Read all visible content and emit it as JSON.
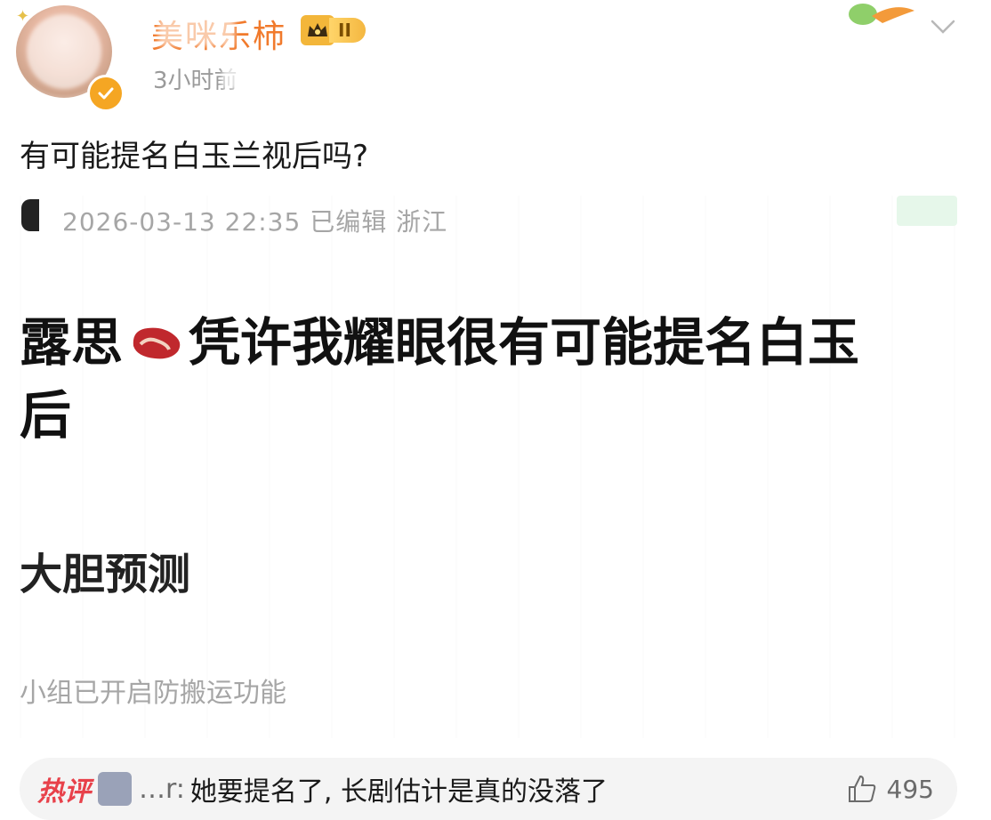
{
  "post": {
    "author_name": "美咪乐柿",
    "level_badge": "II",
    "time": "3小时前",
    "text": "有可能提名白玉兰视后吗?"
  },
  "screenshot": {
    "meta": "2026-03-13 22:35 已编辑 浙江",
    "headline_prefix": "露思",
    "headline_rest": "凭许我耀眼很有可能提名白玉",
    "headline_line2": "后",
    "bold_line": "大胆预测",
    "footer": "小组已开启防搬运功能"
  },
  "hot_comment": {
    "tag": "热评",
    "commenter": "…r:",
    "text": "她要提名了, 长剧估计是真的没落了",
    "like_count": "495"
  },
  "colors": {
    "username": "#f17a2c",
    "hot_tag": "#e8414a",
    "meta_gray": "#a6a6a6",
    "badge_gold": "#f3b63a"
  },
  "icons": [
    "avatar",
    "verified-badge-icon",
    "crown-icon",
    "chevron-down-icon",
    "steak-icon",
    "thumbs-up-icon"
  ]
}
